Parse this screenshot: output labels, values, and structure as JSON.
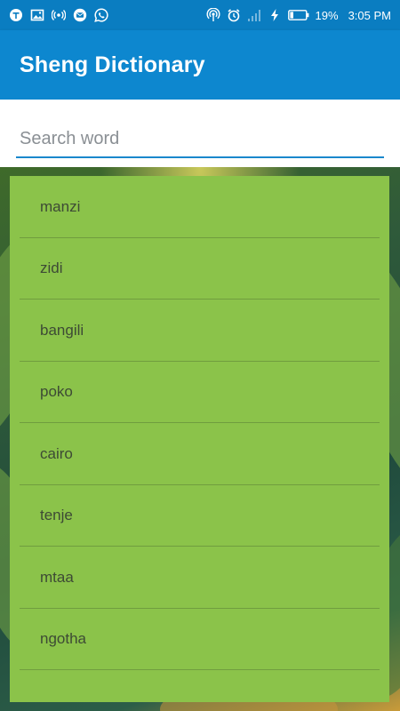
{
  "status_bar": {
    "battery": "19%",
    "time": "3:05 PM",
    "icons_left": [
      "t-icon",
      "image-icon",
      "broadcast-icon",
      "message-icon",
      "whatsapp-icon"
    ],
    "icons_right": [
      "hotspot-icon",
      "alarm-icon",
      "signal-icon",
      "charging-icon",
      "battery-icon"
    ]
  },
  "app_bar": {
    "title": "Sheng Dictionary"
  },
  "search": {
    "placeholder": "Search word",
    "value": ""
  },
  "words": [
    "manzi",
    "zidi",
    "bangili",
    "poko",
    "cairo",
    "tenje",
    "mtaa",
    "ngotha"
  ],
  "colors": {
    "app_bar": "#0d87cf",
    "status_bar": "#0a7dc1",
    "list_bg": "#8bc34a",
    "underline": "#1a88cc"
  }
}
